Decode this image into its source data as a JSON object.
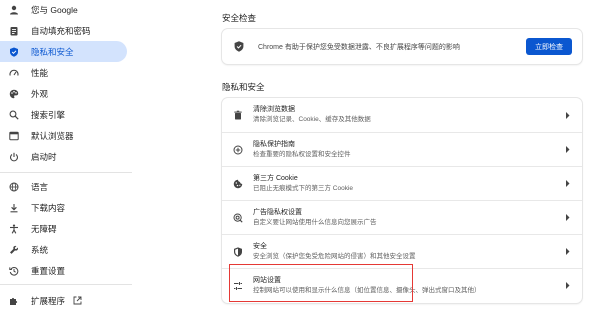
{
  "sidebar": {
    "items": [
      {
        "label": "您与 Google",
        "icon": "person-icon"
      },
      {
        "label": "自动填充和密码",
        "icon": "clipboard-icon"
      },
      {
        "label": "隐私和安全",
        "icon": "shield-icon",
        "active": true
      },
      {
        "label": "性能",
        "icon": "speedometer-icon"
      },
      {
        "label": "外观",
        "icon": "palette-icon"
      },
      {
        "label": "搜索引擎",
        "icon": "search-icon"
      },
      {
        "label": "默认浏览器",
        "icon": "browser-icon"
      },
      {
        "label": "启动时",
        "icon": "power-icon"
      },
      {
        "label": "语言",
        "icon": "globe-icon"
      },
      {
        "label": "下载内容",
        "icon": "download-icon"
      },
      {
        "label": "无障碍",
        "icon": "accessibility-icon"
      },
      {
        "label": "系统",
        "icon": "wrench-icon"
      },
      {
        "label": "重置设置",
        "icon": "history-icon"
      },
      {
        "label": "扩展程序",
        "icon": "puzzle-icon"
      }
    ]
  },
  "safety_check": {
    "title": "安全检查",
    "text": "Chrome 有助于保护您免受数据泄露、不良扩展程序等问题的影响",
    "button": "立即检查"
  },
  "privacy": {
    "title": "隐私和安全",
    "rows": [
      {
        "title": "清除浏览数据",
        "subtitle": "清除浏览记录、Cookie、缓存及其他数据",
        "icon": "trash-icon"
      },
      {
        "title": "隐私保护指南",
        "subtitle": "检查重要的隐私权设置和安全控件",
        "icon": "add-circle-icon"
      },
      {
        "title": "第三方 Cookie",
        "subtitle": "已阻止无痕模式下的第三方 Cookie",
        "icon": "cookie-icon"
      },
      {
        "title": "广告隐私权设置",
        "subtitle": "自定义要让网站使用什么信息向您展示广告",
        "icon": "ads-privacy-icon"
      },
      {
        "title": "安全",
        "subtitle": "安全浏览（保护您免受危险网站的侵害）和其他安全设置",
        "icon": "security-shield-icon"
      },
      {
        "title": "网站设置",
        "subtitle": "控制网站可以使用和显示什么信息（如位置信息、摄像头、弹出式窗口及其他）",
        "icon": "tune-icon"
      }
    ]
  },
  "colors": {
    "accent": "#0b57d0",
    "active_bg": "#d3e3fd",
    "highlight": "#e53935"
  }
}
